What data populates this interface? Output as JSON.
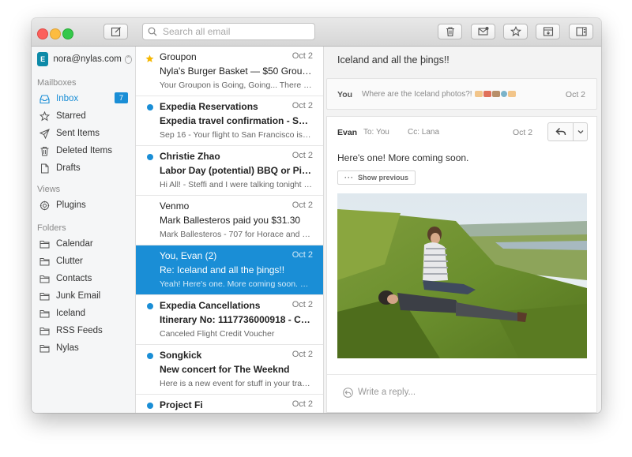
{
  "search": {
    "placeholder": "Search all email"
  },
  "toolbar": {
    "compose_icon": "compose-icon",
    "actions": [
      "trash-icon",
      "mark-read-icon",
      "star-icon",
      "archive-icon",
      "toggle-panel-icon"
    ]
  },
  "colors": {
    "accent": "#1a8ed6",
    "selected_row": "#1a8ed6",
    "account_icon": "#0d8aa8"
  },
  "account": {
    "email": "nora@nylas.com",
    "icon_text": "E"
  },
  "sidebar": {
    "mailboxes_header": "Mailboxes",
    "mailboxes": [
      {
        "label": "Inbox",
        "icon": "inbox-icon",
        "count": "7",
        "active": true
      },
      {
        "label": "Starred",
        "icon": "star-icon"
      },
      {
        "label": "Sent Items",
        "icon": "send-icon"
      },
      {
        "label": "Deleted Items",
        "icon": "trash-icon"
      },
      {
        "label": "Drafts",
        "icon": "draft-icon"
      }
    ],
    "views_header": "Views",
    "views": [
      {
        "label": "Plugins",
        "icon": "plugin-icon"
      }
    ],
    "folders_header": "Folders",
    "folders": [
      {
        "label": "Calendar"
      },
      {
        "label": "Clutter"
      },
      {
        "label": "Contacts"
      },
      {
        "label": "Junk Email"
      },
      {
        "label": "Iceland"
      },
      {
        "label": "RSS Feeds"
      },
      {
        "label": "Nylas"
      }
    ]
  },
  "threads": [
    {
      "sender": "Groupon",
      "date": "Oct 2",
      "subject": "Nyla's Burger Basket — $50 Groupon to...",
      "snippet": "Your Groupon is Going, Going... There are...",
      "marker": "star",
      "unread": false
    },
    {
      "sender": "Expedia Reservations",
      "date": "Oct 2",
      "subject": "Expedia travel confirmation - Sep 16 ...",
      "snippet": "Sep 16 - Your flight to San Francisco is bo...",
      "marker": "dot",
      "unread": true
    },
    {
      "sender": "Christie Zhao",
      "date": "Oct 2",
      "subject": "Labor Day (potential) BBQ or Picnic",
      "snippet": "Hi All! - Steffi and I were talking tonight ab...",
      "marker": "dot",
      "unread": true
    },
    {
      "sender": "Venmo",
      "date": "Oct 2",
      "subject": "Mark Ballesteros paid you $31.30",
      "snippet": "Mark Ballesteros - 707 for Horace and me",
      "marker": "none",
      "unread": false
    },
    {
      "sender": "You, Evan (2)",
      "date": "Oct 2",
      "subject": "Re: Iceland and all the þings!!",
      "snippet": "Yeah! Here's one. More coming soon. On S...",
      "marker": "none",
      "unread": false,
      "selected": true
    },
    {
      "sender": "Expedia Cancellations",
      "date": "Oct 2",
      "subject": "Itinerary No: 1117736000918 - Cance...",
      "snippet": "Canceled Flight Credit Voucher",
      "marker": "dot",
      "unread": true
    },
    {
      "sender": "Songkick",
      "date": "Oct 2",
      "subject": "New concert for The Weeknd",
      "snippet": "Here is a new event for stuff in your tracker...",
      "marker": "dot",
      "unread": true
    },
    {
      "sender": "Project Fi",
      "date": "Oct 2",
      "subject": "",
      "snippet": "",
      "marker": "dot",
      "unread": true
    }
  ],
  "message_view": {
    "thread_title": "Iceland and all the þings!!",
    "collapsed": {
      "from": "You",
      "preview": "Where are the Iceland photos?!",
      "date": "Oct 2"
    },
    "expanded": {
      "from": "Evan",
      "to": "To: You",
      "cc": "Cc: Lana",
      "date": "Oct 2",
      "body": "Here's one! More coming soon.",
      "show_previous": "Show previous",
      "reply_icon": "reply-icon",
      "dropdown_icon": "chevron-down-icon"
    },
    "reply_placeholder": "Write a reply..."
  }
}
